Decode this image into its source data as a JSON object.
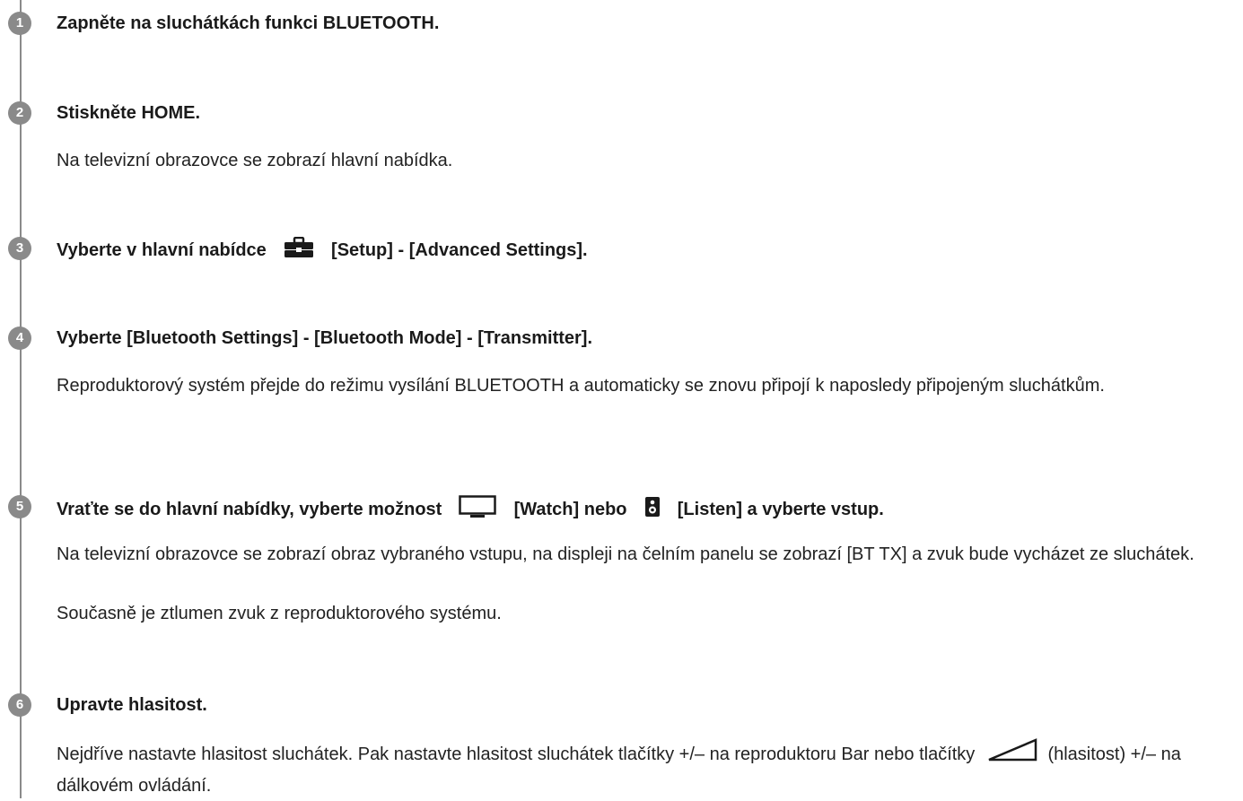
{
  "steps": [
    {
      "number": "1",
      "heading": "Zapněte na sluchátkách funkci BLUETOOTH."
    },
    {
      "number": "2",
      "heading": "Stiskněte HOME.",
      "body": [
        "Na televizní obrazovce se zobrazí hlavní nabídka."
      ]
    },
    {
      "number": "3",
      "heading_before": "Vyberte v hlavní nabídce",
      "heading_icon": "toolbox-icon",
      "heading_after": "[Setup] - [Advanced Settings]."
    },
    {
      "number": "4",
      "heading": "Vyberte [Bluetooth Settings] - [Bluetooth Mode] - [Transmitter].",
      "body": [
        "Reproduktorový systém přejde do režimu vysílání BLUETOOTH a automaticky se znovu připojí k naposledy připojeným sluchátkům."
      ]
    },
    {
      "number": "5",
      "heading_before": "Vraťte se do hlavní nabídky, vyberte možnost",
      "heading_icon_1": "tv-icon",
      "heading_mid": "[Watch] nebo",
      "heading_icon_2": "speaker-icon",
      "heading_after": "[Listen] a vyberte vstup.",
      "body": [
        "Na televizní obrazovce se zobrazí obraz vybraného vstupu, na displeji na čelním panelu se zobrazí [BT TX] a zvuk bude vycházet ze sluchátek.",
        "Současně je ztlumen zvuk z reproduktorového systému."
      ]
    },
    {
      "number": "6",
      "heading": "Upravte hlasitost.",
      "body_before": "Nejdříve nastavte hlasitost sluchátek. Pak nastavte hlasitost sluchátek tlačítky +/– na reproduktoru Bar nebo tlačítky",
      "body_icon": "volume-icon",
      "body_after": "(hlasitost) +/– na dálkovém ovládání."
    }
  ],
  "colors": {
    "badge": "#8a8a8a",
    "text": "#1a1a1a"
  }
}
